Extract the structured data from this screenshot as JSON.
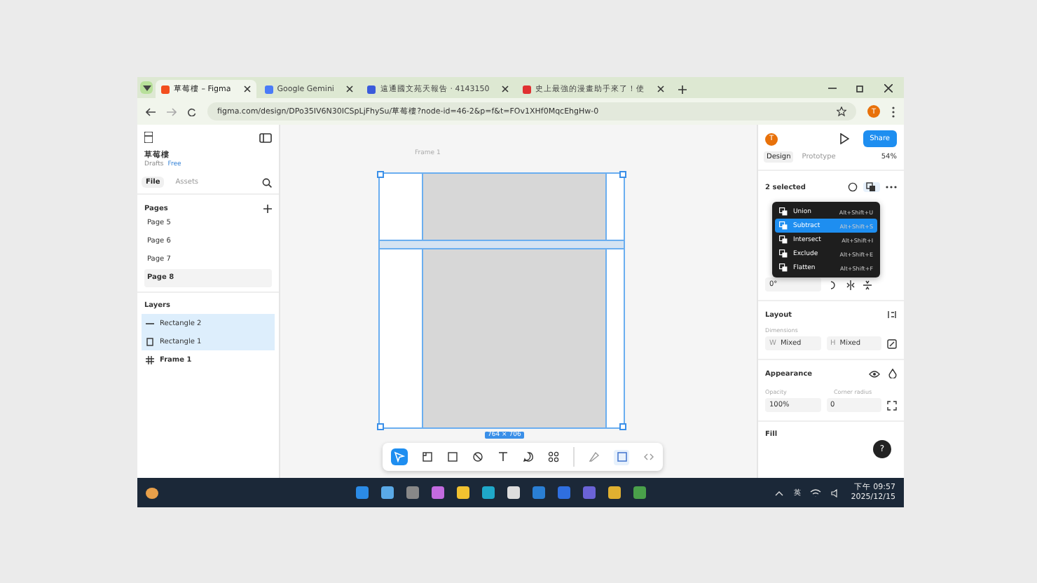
{
  "browser": {
    "tabs": [
      {
        "title": "草莓樓 – Figma",
        "selected": true,
        "kind": "figma"
      },
      {
        "title": "Google Gemini",
        "selected": false,
        "kind": "gemini"
      },
      {
        "title": "遠通國文苑天報告 · 4143150",
        "selected": false,
        "kind": "doc"
      },
      {
        "title": "史上最強的漫畫助手來了！使",
        "selected": false,
        "kind": "video"
      }
    ],
    "url": "figma.com/design/DPo35IV6N30ICSpLjFhySu/草莓樓?node-id=46-2&p=f&t=FOv1XHf0MqcEhgHw-0",
    "profile": "T"
  },
  "left_panel": {
    "file_name": "草莓樓",
    "plan_label": "Drafts",
    "plan": "Free",
    "tabs": [
      {
        "label": "File",
        "selected": true
      },
      {
        "label": "Assets",
        "selected": false
      }
    ],
    "pages_title": "Pages",
    "pages": [
      {
        "name": "Page 5",
        "selected": false
      },
      {
        "name": "Page 6",
        "selected": false
      },
      {
        "name": "Page 7",
        "selected": false
      },
      {
        "name": "Page 8",
        "selected": true
      }
    ],
    "layers_title": "Layers",
    "layers": [
      {
        "name": "Rectangle 2",
        "kind": "line",
        "selected": true
      },
      {
        "name": "Rectangle 1",
        "kind": "rect",
        "selected": true
      },
      {
        "name": "Frame 1",
        "kind": "frame",
        "selected": false
      }
    ]
  },
  "canvas": {
    "frame_label": "Frame 1",
    "size_badge": "764 × 706"
  },
  "right_panel": {
    "avatar": "T",
    "share": "Share",
    "tabs": [
      {
        "label": "Design",
        "selected": true
      },
      {
        "label": "Prototype",
        "selected": false
      }
    ],
    "zoom": "54%",
    "selection_title": "2 selected",
    "boolean_menu": [
      {
        "label": "Union",
        "shortcut": "Alt+Shift+U",
        "selected": false
      },
      {
        "label": "Subtract",
        "shortcut": "Alt+Shift+S",
        "selected": true
      },
      {
        "label": "Intersect",
        "shortcut": "Alt+Shift+I",
        "selected": false
      },
      {
        "label": "Exclude",
        "shortcut": "Alt+Shift+E",
        "selected": false
      },
      {
        "label": "Flatten",
        "shortcut": "Alt+Shift+F",
        "selected": false
      }
    ],
    "rotation": "0°",
    "layout_title": "Layout",
    "dimensions_label": "Dimensions",
    "width_prefix": "W",
    "width": "Mixed",
    "height_prefix": "H",
    "height": "Mixed",
    "appearance_title": "Appearance",
    "opacity_label": "Opacity",
    "opacity": "100%",
    "radius_label": "Corner radius",
    "radius": "0",
    "fill_title": "Fill",
    "help": "?"
  },
  "taskbar": {
    "ime": "英",
    "time": "下午 09:57",
    "date": "2025/12/15"
  }
}
